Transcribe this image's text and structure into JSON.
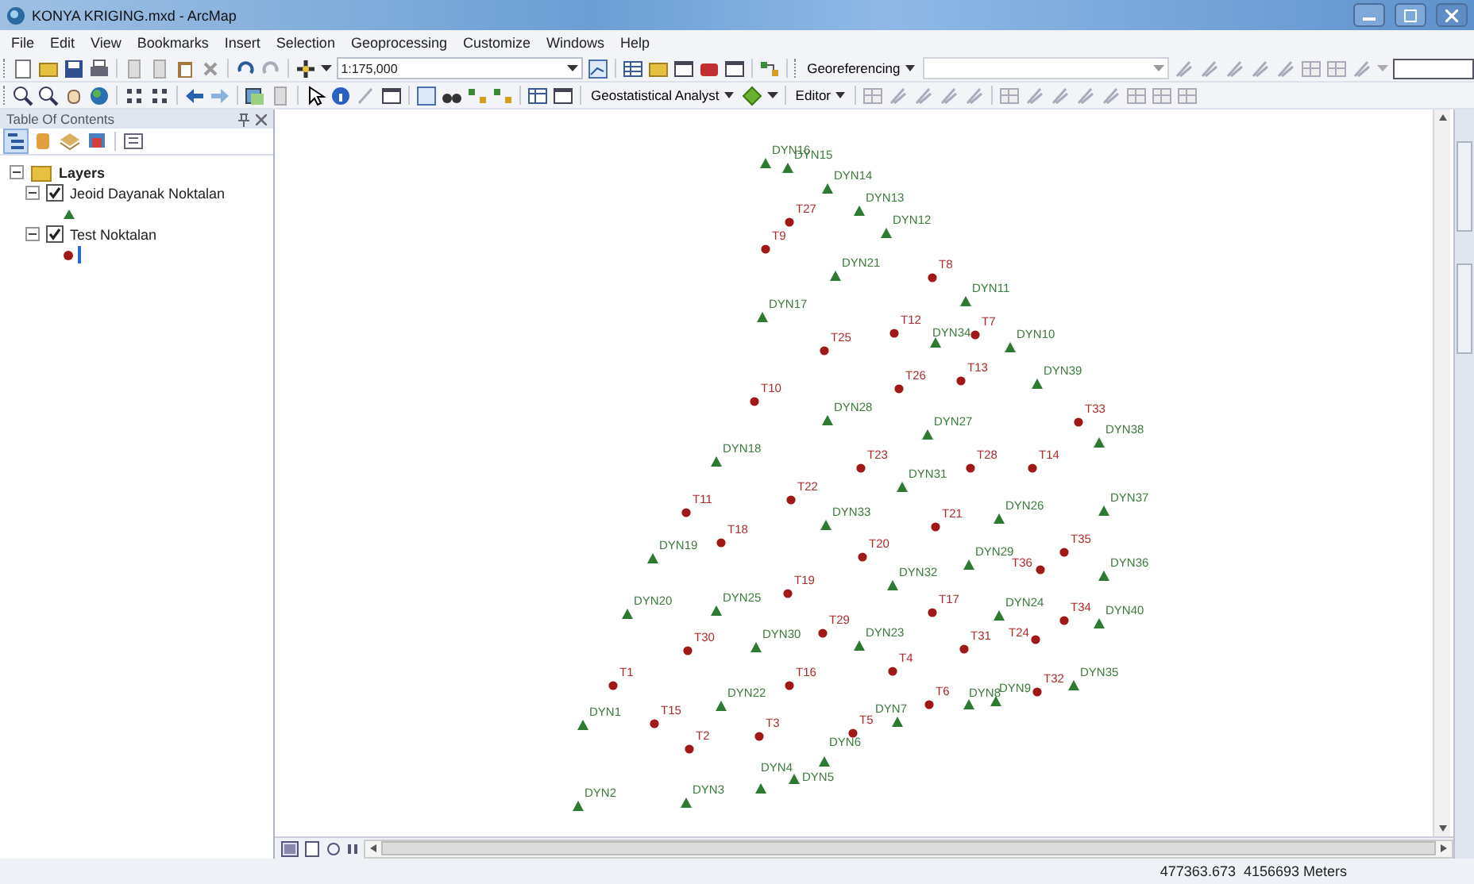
{
  "window": {
    "title": "KONYA KRIGING.mxd - ArcMap"
  },
  "menu": [
    "File",
    "Edit",
    "View",
    "Bookmarks",
    "Insert",
    "Selection",
    "Geoprocessing",
    "Customize",
    "Windows",
    "Help"
  ],
  "toolbar": {
    "scale": "1:175,000",
    "georeferencing": "Georeferencing",
    "geostatistical": "Geostatistical Analyst",
    "editor": "Editor"
  },
  "toc": {
    "title": "Table Of Contents",
    "root": {
      "label": "Layers",
      "expanded": true,
      "children": [
        {
          "label": "Jeoid Dayanak Noktalan",
          "checked": true,
          "expanded": true,
          "kind": "triangle"
        },
        {
          "label": "Test Noktalan",
          "checked": true,
          "expanded": true,
          "kind": "dot"
        }
      ]
    }
  },
  "map": {
    "points": [
      {
        "label": "DYN16",
        "kind": "triangle"
      },
      {
        "label": "DYN15",
        "kind": "triangle"
      },
      {
        "label": "DYN14",
        "kind": "triangle"
      },
      {
        "label": "T27",
        "kind": "dot"
      },
      {
        "label": "DYN13",
        "kind": "triangle"
      },
      {
        "label": "T9",
        "kind": "dot"
      },
      {
        "label": "DYN12",
        "kind": "triangle"
      },
      {
        "label": "DYN21",
        "kind": "triangle"
      },
      {
        "label": "T8",
        "kind": "dot"
      },
      {
        "label": "DYN17",
        "kind": "triangle"
      },
      {
        "label": "DYN11",
        "kind": "triangle"
      },
      {
        "label": "T25",
        "kind": "dot"
      },
      {
        "label": "T12",
        "kind": "dot"
      },
      {
        "label": "DYN34",
        "kind": "triangle"
      },
      {
        "label": "T7",
        "kind": "dot"
      },
      {
        "label": "DYN10",
        "kind": "triangle"
      },
      {
        "label": "T10",
        "kind": "dot"
      },
      {
        "label": "T26",
        "kind": "dot"
      },
      {
        "label": "T13",
        "kind": "dot"
      },
      {
        "label": "DYN39",
        "kind": "triangle"
      },
      {
        "label": "DYN28",
        "kind": "triangle"
      },
      {
        "label": "DYN27",
        "kind": "triangle"
      },
      {
        "label": "T33",
        "kind": "dot"
      },
      {
        "label": "DYN38",
        "kind": "triangle"
      },
      {
        "label": "DYN18",
        "kind": "triangle"
      },
      {
        "label": "T23",
        "kind": "dot"
      },
      {
        "label": "T28",
        "kind": "dot"
      },
      {
        "label": "T14",
        "kind": "dot"
      },
      {
        "label": "T11",
        "kind": "dot"
      },
      {
        "label": "T22",
        "kind": "dot"
      },
      {
        "label": "DYN33",
        "kind": "triangle"
      },
      {
        "label": "DYN31",
        "kind": "triangle"
      },
      {
        "label": "T21",
        "kind": "dot"
      },
      {
        "label": "DYN26",
        "kind": "triangle"
      },
      {
        "label": "DYN37",
        "kind": "triangle"
      },
      {
        "label": "DYN19",
        "kind": "triangle"
      },
      {
        "label": "T18",
        "kind": "dot"
      },
      {
        "label": "T20",
        "kind": "dot"
      },
      {
        "label": "DYN29",
        "kind": "triangle"
      },
      {
        "label": "T36",
        "kind": "dot"
      },
      {
        "label": "T35",
        "kind": "dot"
      },
      {
        "label": "DYN36",
        "kind": "triangle"
      },
      {
        "label": "DYN20",
        "kind": "triangle"
      },
      {
        "label": "DYN25",
        "kind": "triangle"
      },
      {
        "label": "T19",
        "kind": "dot"
      },
      {
        "label": "DYN32",
        "kind": "triangle"
      },
      {
        "label": "T17",
        "kind": "dot"
      },
      {
        "label": "DYN24",
        "kind": "triangle"
      },
      {
        "label": "T34",
        "kind": "dot"
      },
      {
        "label": "DYN40",
        "kind": "triangle"
      },
      {
        "label": "T30",
        "kind": "dot"
      },
      {
        "label": "DYN30",
        "kind": "triangle"
      },
      {
        "label": "T29",
        "kind": "dot"
      },
      {
        "label": "DYN23",
        "kind": "triangle"
      },
      {
        "label": "T31",
        "kind": "dot"
      },
      {
        "label": "T24",
        "kind": "dot"
      },
      {
        "label": "T1",
        "kind": "dot"
      },
      {
        "label": "T16",
        "kind": "dot"
      },
      {
        "label": "T4",
        "kind": "dot"
      },
      {
        "label": "T32",
        "kind": "dot"
      },
      {
        "label": "DYN35",
        "kind": "triangle"
      },
      {
        "label": "DYN22",
        "kind": "triangle"
      },
      {
        "label": "T6",
        "kind": "dot"
      },
      {
        "label": "DYN8",
        "kind": "triangle"
      },
      {
        "label": "DYN9",
        "kind": "triangle"
      },
      {
        "label": "DYN1",
        "kind": "triangle"
      },
      {
        "label": "T15",
        "kind": "dot"
      },
      {
        "label": "T3",
        "kind": "dot"
      },
      {
        "label": "T5",
        "kind": "dot"
      },
      {
        "label": "DYN7",
        "kind": "triangle"
      },
      {
        "label": "T2",
        "kind": "dot"
      },
      {
        "label": "DYN4",
        "kind": "triangle"
      },
      {
        "label": "DYN5",
        "kind": "triangle"
      },
      {
        "label": "DYN6",
        "kind": "triangle"
      },
      {
        "label": "DYN2",
        "kind": "triangle"
      },
      {
        "label": "DYN3",
        "kind": "triangle"
      }
    ]
  },
  "status_bar": {
    "coordinates": "477363.673  4156693 Meters"
  }
}
